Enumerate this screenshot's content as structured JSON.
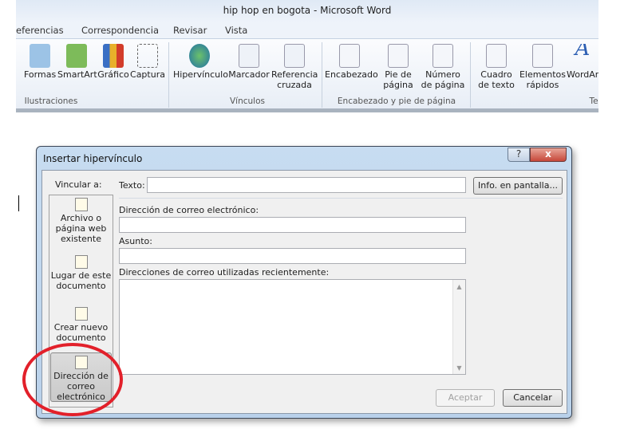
{
  "window": {
    "title": "hip hop en bogota  -  Microsoft Word"
  },
  "tabs": [
    "eferencias",
    "Correspondencia",
    "Revisar",
    "Vista"
  ],
  "ribbon": {
    "buttons": [
      {
        "label": "Formas",
        "icon": "shapes-icon"
      },
      {
        "label": "SmartArt",
        "icon": "smartart-icon"
      },
      {
        "label": "Gráfico",
        "icon": "chart-icon"
      },
      {
        "label": "Captura",
        "icon": "screenshot-icon"
      },
      {
        "label": "Hipervínculo",
        "icon": "hyperlink-globe-icon"
      },
      {
        "label": "Marcador",
        "icon": "bookmark-icon"
      },
      {
        "label": "Referencia cruzada",
        "icon": "cross-reference-icon"
      },
      {
        "label": "Encabezado",
        "icon": "header-icon"
      },
      {
        "label": "Pie de página",
        "icon": "footer-icon"
      },
      {
        "label": "Número de página",
        "icon": "page-number-icon"
      },
      {
        "label": "Cuadro de texto",
        "icon": "text-box-icon"
      },
      {
        "label": "Elementos rápidos",
        "icon": "quick-parts-icon"
      },
      {
        "label": "WordAr",
        "icon": "wordart-icon"
      }
    ],
    "groups": [
      "Ilustraciones",
      "Vínculos",
      "Encabezado y pie de página",
      "Te"
    ]
  },
  "dialog": {
    "title": "Insertar hipervínculo",
    "help": "?",
    "close": "x",
    "link_to_label": "Vincular a:",
    "nav": [
      "Archivo o página web existente",
      "Lugar de este documento",
      "Crear nuevo documento",
      "Dirección de correo electrónico"
    ],
    "text_label": "Texto:",
    "text_value": "",
    "screentip_button": "Info. en pantalla...",
    "email_label": "Dirección de correo electrónico:",
    "email_value": "",
    "subject_label": "Asunto:",
    "subject_value": "",
    "recent_label": "Direcciones de correo utilizadas recientemente:",
    "ok": "Aceptar",
    "cancel": "Cancelar"
  }
}
